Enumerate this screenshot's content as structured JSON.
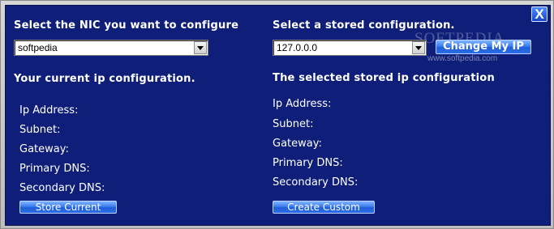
{
  "close_label": "X",
  "left": {
    "nic_heading": "Select the NIC you want to configure",
    "nic_selected": "softpedia",
    "config_heading": "Your current ip configuration.",
    "fields": [
      "Ip Address:",
      "Subnet:",
      "Gateway:",
      "Primary DNS:",
      "Secondary DNS:"
    ],
    "store_button": "Store Current"
  },
  "right": {
    "stored_heading": "Select a stored configuration.",
    "stored_selected": "127.0.0.0",
    "change_button": "Change My IP",
    "config_heading": "The selected stored ip configuration",
    "fields": [
      "Ip Address:",
      "Subnet:",
      "Gateway:",
      "Primary DNS:",
      "Secondary DNS:"
    ],
    "create_button": "Create Custom"
  },
  "watermark": {
    "brand": "SOFTPEDIA",
    "url": "www.softpedia.com"
  },
  "colors": {
    "panel": "#0f1e78",
    "button": "#2c6de8",
    "frame": "#c9c9c9"
  }
}
